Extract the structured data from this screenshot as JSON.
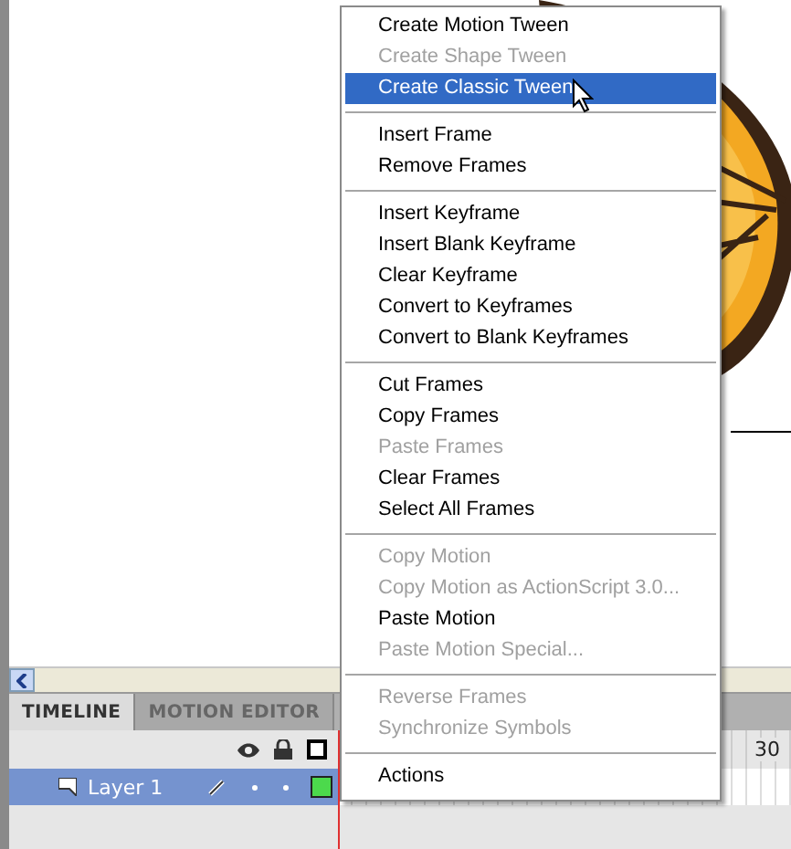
{
  "timeline": {
    "tabs": [
      {
        "label": "TIMELINE",
        "selected": true
      },
      {
        "label": "MOTION EDITOR",
        "selected": false
      }
    ],
    "ruler_label": "30",
    "layers": [
      {
        "name": "Layer 1",
        "selected": true,
        "color": "#4cd94c"
      }
    ]
  },
  "context_menu": {
    "groups": [
      [
        {
          "label": "Create Motion Tween",
          "disabled": false,
          "selected": false
        },
        {
          "label": "Create Shape Tween",
          "disabled": true,
          "selected": false
        },
        {
          "label": "Create Classic Tween",
          "disabled": false,
          "selected": true
        }
      ],
      [
        {
          "label": "Insert Frame",
          "disabled": false,
          "selected": false
        },
        {
          "label": "Remove Frames",
          "disabled": false,
          "selected": false
        }
      ],
      [
        {
          "label": "Insert Keyframe",
          "disabled": false,
          "selected": false
        },
        {
          "label": "Insert Blank Keyframe",
          "disabled": false,
          "selected": false
        },
        {
          "label": "Clear Keyframe",
          "disabled": false,
          "selected": false
        },
        {
          "label": "Convert to Keyframes",
          "disabled": false,
          "selected": false
        },
        {
          "label": "Convert to Blank Keyframes",
          "disabled": false,
          "selected": false
        }
      ],
      [
        {
          "label": "Cut Frames",
          "disabled": false,
          "selected": false
        },
        {
          "label": "Copy Frames",
          "disabled": false,
          "selected": false
        },
        {
          "label": "Paste Frames",
          "disabled": true,
          "selected": false
        },
        {
          "label": "Clear Frames",
          "disabled": false,
          "selected": false
        },
        {
          "label": "Select All Frames",
          "disabled": false,
          "selected": false
        }
      ],
      [
        {
          "label": "Copy Motion",
          "disabled": true,
          "selected": false
        },
        {
          "label": "Copy Motion as ActionScript 3.0...",
          "disabled": true,
          "selected": false
        },
        {
          "label": "Paste Motion",
          "disabled": false,
          "selected": false
        },
        {
          "label": "Paste Motion Special...",
          "disabled": true,
          "selected": false
        }
      ],
      [
        {
          "label": "Reverse Frames",
          "disabled": true,
          "selected": false
        },
        {
          "label": "Synchronize Symbols",
          "disabled": true,
          "selected": false
        }
      ],
      [
        {
          "label": "Actions",
          "disabled": false,
          "selected": false
        }
      ]
    ]
  }
}
